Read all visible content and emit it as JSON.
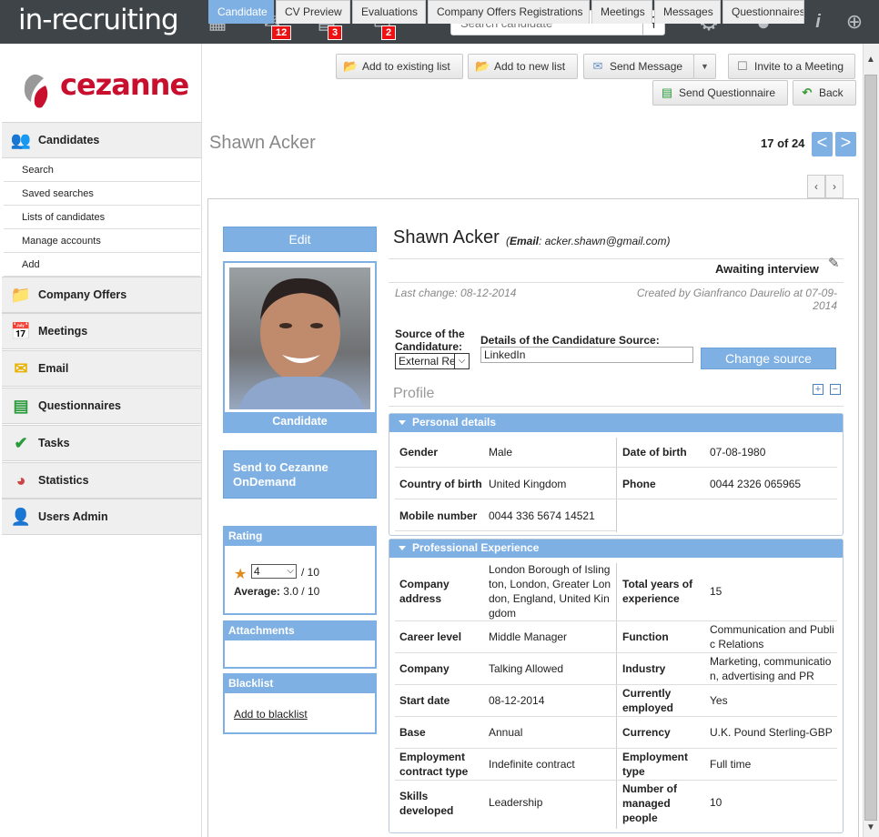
{
  "app": {
    "brand": "in-recruiting",
    "badges": {
      "inbox": "12",
      "calendar": "3",
      "tasks": "2"
    },
    "search_placeholder": "Search candidate"
  },
  "logo": {
    "text": "cezanne"
  },
  "sidebar": {
    "candidates": "Candidates",
    "subitems": [
      "Search",
      "Saved searches",
      "Lists of candidates",
      "Manage accounts",
      "Add"
    ],
    "sections": [
      "Company Offers",
      "Meetings",
      "Email",
      "Questionnaires",
      "Tasks",
      "Statistics",
      "Users Admin"
    ]
  },
  "toolbar": {
    "add_existing": "Add to existing list",
    "add_new": "Add to new list",
    "send_message": "Send Message",
    "invite": "Invite to a Meeting",
    "send_questionnaire": "Send Questionnaire",
    "back": "Back"
  },
  "header": {
    "title": "Shawn Acker",
    "pager": "17 of 24"
  },
  "tabs": [
    "Candidate",
    "CV Preview",
    "Evaluations",
    "Company Offers Registrations",
    "Meetings",
    "Messages",
    "Questionnaires"
  ],
  "left": {
    "edit": "Edit",
    "photo_caption": "Candidate",
    "send_ondemand": "Send to Cezanne OnDemand",
    "rating": {
      "title": "Rating",
      "value": "4",
      "outof": "/ 10",
      "avg_label": "Average:",
      "avg_value": "3.0 / 10"
    },
    "attachments": "Attachments",
    "blacklist": {
      "title": "Blacklist",
      "link": "Add to blacklist"
    }
  },
  "candidate": {
    "name": "Shawn Acker",
    "email_label": "Email",
    "email": "acker.shawn@gmail.com",
    "status": "Awaiting interview",
    "last_change": "Last change: 08-12-2014",
    "created": "Created by Gianfranco Daurelio at 07-09-2014",
    "source_label": "Source of the Candidature:",
    "source_value": "External Re",
    "details_label": "Details of the Candidature Source:",
    "details_value": "LinkedIn",
    "change_source": "Change source",
    "profile": "Profile"
  },
  "personal": {
    "title": "Personal details",
    "rows": [
      [
        "Gender",
        "Male",
        "Date of birth",
        "07-08-1980"
      ],
      [
        "Country of birth",
        "United Kingdom",
        "Phone",
        "0044 2326 065965"
      ],
      [
        "Mobile number",
        "0044 336 5674 14521",
        "",
        ""
      ]
    ]
  },
  "professional": {
    "title": "Professional Experience",
    "rows": [
      [
        "Company address",
        "London Borough of Islington, London, Greater London, England, United Kingdom",
        "Total years of experience",
        "15"
      ],
      [
        "Career level",
        "Middle Manager",
        "Function",
        "Communication and Public Relations"
      ],
      [
        "Company",
        "Talking Allowed",
        "Industry",
        "Marketing, communication, advertising and PR"
      ],
      [
        "Start date",
        "08-12-2014",
        "Currently employed",
        "Yes"
      ],
      [
        "Base",
        "Annual",
        "Currency",
        "U.K. Pound Sterling-GBP"
      ],
      [
        "Employment contract type",
        "Indefinite contract",
        "Employment type",
        "Full time"
      ],
      [
        "Skills developed",
        "Leadership",
        "Number of managed people",
        "10"
      ]
    ]
  }
}
